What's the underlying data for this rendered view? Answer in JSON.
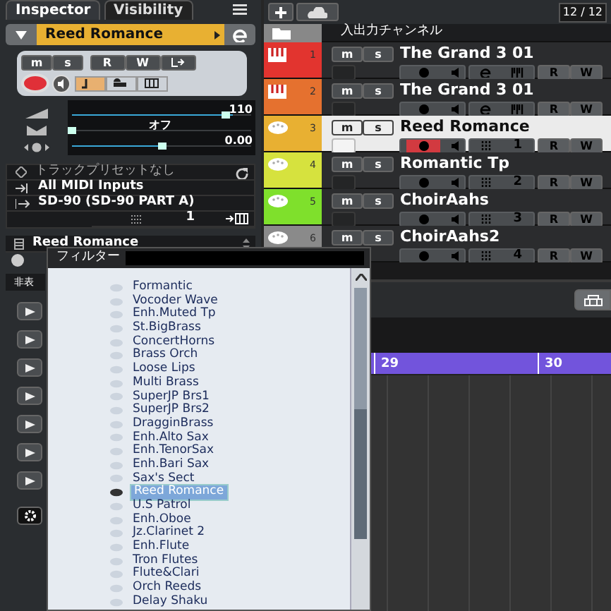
{
  "inspector": {
    "tabs": [
      {
        "label": "Inspector",
        "selected": true
      },
      {
        "label": "Visibility",
        "selected": false
      }
    ],
    "track_name": "Reed Romance",
    "buttons": [
      "m",
      "s",
      "R",
      "W"
    ],
    "record_armed": true,
    "sliders": [
      {
        "reading": "110",
        "level": 0.86
      },
      {
        "reading": "オフ",
        "level": 0.0
      },
      {
        "reading": "0.00",
        "level": 0.5
      }
    ],
    "preset": "トラックプリセットなし",
    "input": "All MIDI Inputs",
    "output": "SD-90 (SD-90 PART A)",
    "channel": "1",
    "program": "Reed Romance",
    "hidden_label": "非表"
  },
  "tracks_header": {
    "counter": "12 / 12",
    "folder": "入出力チャンネル"
  },
  "tracks": [
    {
      "number": "1",
      "name": "The Grand 3 01",
      "color": "#e2342f",
      "kind": "instrument",
      "selected": false,
      "record": false,
      "buttons": [
        "m",
        "s",
        "R",
        "W"
      ]
    },
    {
      "number": "2",
      "name": "The Grand 3 01",
      "color": "#e5712f",
      "kind": "instrument",
      "selected": false,
      "record": false,
      "buttons": [
        "m",
        "s",
        "R",
        "W"
      ]
    },
    {
      "number": "3",
      "name": "Reed Romance",
      "color": "#e8b032",
      "kind": "midi",
      "channel": "1",
      "selected": true,
      "record": true,
      "buttons": [
        "m",
        "s",
        "R",
        "W"
      ]
    },
    {
      "number": "4",
      "name": "Romantic Tp",
      "color": "#d6e23e",
      "kind": "midi",
      "channel": "2",
      "selected": false,
      "record": false,
      "buttons": [
        "m",
        "s",
        "R",
        "W"
      ]
    },
    {
      "number": "5",
      "name": "ChoirAahs",
      "color": "#7fe02c",
      "kind": "midi",
      "channel": "3",
      "selected": false,
      "record": false,
      "buttons": [
        "m",
        "s",
        "R",
        "W"
      ]
    },
    {
      "number": "6",
      "name": "ChoirAahs2",
      "color": "#8a8a8a",
      "kind": "midi",
      "channel": "4",
      "selected": false,
      "record": false,
      "buttons": [
        "m",
        "s",
        "R",
        "W"
      ]
    }
  ],
  "ruler": {
    "marks": [
      "29",
      "30"
    ]
  },
  "program_menu": {
    "filter_label": "フィルター",
    "items": [
      {
        "label": "Formantic",
        "selected": false
      },
      {
        "label": "Vocoder Wave",
        "selected": false
      },
      {
        "label": "Enh.Muted Tp",
        "selected": false
      },
      {
        "label": "St.BigBrass",
        "selected": false
      },
      {
        "label": "ConcertHorns",
        "selected": false
      },
      {
        "label": "Brass Orch",
        "selected": false
      },
      {
        "label": "Loose Lips",
        "selected": false
      },
      {
        "label": "Multi Brass",
        "selected": false
      },
      {
        "label": "SuperJP Brs1",
        "selected": false
      },
      {
        "label": "SuperJP Brs2",
        "selected": false
      },
      {
        "label": "DragginBrass",
        "selected": false
      },
      {
        "label": "Enh.Alto Sax",
        "selected": false
      },
      {
        "label": "Enh.TenorSax",
        "selected": false
      },
      {
        "label": "Enh.Bari Sax",
        "selected": false
      },
      {
        "label": "Sax's Sect",
        "selected": false
      },
      {
        "label": "Reed Romance",
        "selected": true
      },
      {
        "label": "U.S Patrol",
        "selected": false
      },
      {
        "label": "Enh.Oboe",
        "selected": false
      },
      {
        "label": "Jz.Clarinet 2",
        "selected": false
      },
      {
        "label": "Enh.Flute",
        "selected": false
      },
      {
        "label": "Tron Flutes",
        "selected": false
      },
      {
        "label": "Flute&Clari",
        "selected": false
      },
      {
        "label": "Orch Reeds",
        "selected": false
      },
      {
        "label": "Delay Shaku",
        "selected": false
      }
    ]
  }
}
